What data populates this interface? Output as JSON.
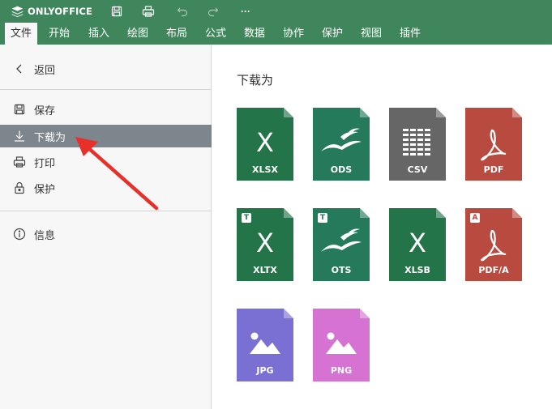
{
  "app": {
    "name": "ONLYOFFICE"
  },
  "colors": {
    "brand": "#40865c",
    "selected": "#7c868c",
    "panel": "#f7f7f7",
    "annotation_arrow": "#e8302a"
  },
  "toolbar": {
    "icons": [
      "save-icon",
      "print-icon",
      "undo-icon",
      "redo-icon",
      "more-icon"
    ],
    "more_label": "···"
  },
  "tabs": [
    {
      "label": "文件",
      "active": true
    },
    {
      "label": "开始"
    },
    {
      "label": "插入"
    },
    {
      "label": "绘图"
    },
    {
      "label": "布局"
    },
    {
      "label": "公式"
    },
    {
      "label": "数据"
    },
    {
      "label": "协作"
    },
    {
      "label": "保护"
    },
    {
      "label": "视图"
    },
    {
      "label": "插件"
    }
  ],
  "sidebar": {
    "back_label": "返回",
    "items": [
      {
        "label": "保存",
        "icon": "save-icon"
      },
      {
        "label": "下载为",
        "icon": "download-icon",
        "selected": true
      },
      {
        "label": "打印",
        "icon": "print-icon"
      },
      {
        "label": "保护",
        "icon": "lock-icon"
      }
    ],
    "info_label": "信息"
  },
  "main": {
    "title": "下载为",
    "formats": [
      {
        "label": "XLSX",
        "color": "#24744a",
        "glyph": "X"
      },
      {
        "label": "ODS",
        "color": "#247a5a",
        "glyph": "ods"
      },
      {
        "label": "CSV",
        "color": "#666666",
        "glyph": "grid"
      },
      {
        "label": "PDF",
        "color": "#b94a3f",
        "glyph": "pdf"
      },
      {
        "label": "XLTX",
        "color": "#24744a",
        "glyph": "X",
        "badge": "T"
      },
      {
        "label": "OTS",
        "color": "#247a5a",
        "glyph": "ods",
        "badge": "T"
      },
      {
        "label": "XLSB",
        "color": "#24744a",
        "glyph": "X"
      },
      {
        "label": "PDF/A",
        "color": "#b94a3f",
        "glyph": "pdf",
        "badge": "A"
      },
      {
        "label": "JPG",
        "color": "#7a6fd3",
        "glyph": "image"
      },
      {
        "label": "PNG",
        "color": "#d672d2",
        "glyph": "image"
      }
    ]
  }
}
